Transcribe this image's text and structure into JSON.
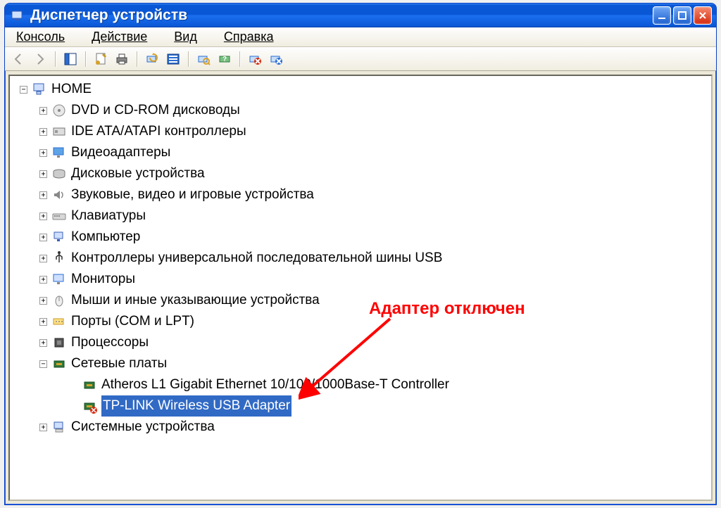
{
  "title": "Диспетчер устройств",
  "menu": {
    "console": "Консоль",
    "action": "Действие",
    "view": "Вид",
    "help": "Справка"
  },
  "toolbar_icons": [
    "nav-back-icon",
    "nav-fwd-icon",
    "show-tree-icon",
    "properties-icon",
    "print-icon",
    "refresh-icon",
    "details-icon",
    "scan-hardware-icon",
    "help-tool-icon",
    "disable-icon",
    "uninstall-icon"
  ],
  "tree": {
    "root": {
      "label": "HOME"
    },
    "items": [
      {
        "label": "DVD и CD-ROM дисководы",
        "icon": "disc"
      },
      {
        "label": "IDE ATA/ATAPI контроллеры",
        "icon": "ide"
      },
      {
        "label": "Видеоадаптеры",
        "icon": "display"
      },
      {
        "label": "Дисковые устройства",
        "icon": "disk"
      },
      {
        "label": "Звуковые, видео и игровые устройства",
        "icon": "sound"
      },
      {
        "label": "Клавиатуры",
        "icon": "keyboard"
      },
      {
        "label": "Компьютер",
        "icon": "computer"
      },
      {
        "label": "Контроллеры универсальной последовательной шины USB",
        "icon": "usb"
      },
      {
        "label": "Мониторы",
        "icon": "monitor"
      },
      {
        "label": "Мыши и иные указывающие устройства",
        "icon": "mouse"
      },
      {
        "label": "Порты (COM и LPT)",
        "icon": "port"
      },
      {
        "label": "Процессоры",
        "icon": "cpu"
      },
      {
        "label": "Сетевые платы",
        "icon": "net",
        "expanded": true
      },
      {
        "label": "Системные устройства",
        "icon": "system"
      }
    ],
    "net_children": [
      {
        "label": "Atheros L1 Gigabit Ethernet 10/100/1000Base-T Controller",
        "selected": false,
        "disabled": false
      },
      {
        "label": "TP-LINK Wireless USB Adapter",
        "selected": true,
        "disabled": true
      }
    ]
  },
  "annotation": "Адаптер отключен"
}
